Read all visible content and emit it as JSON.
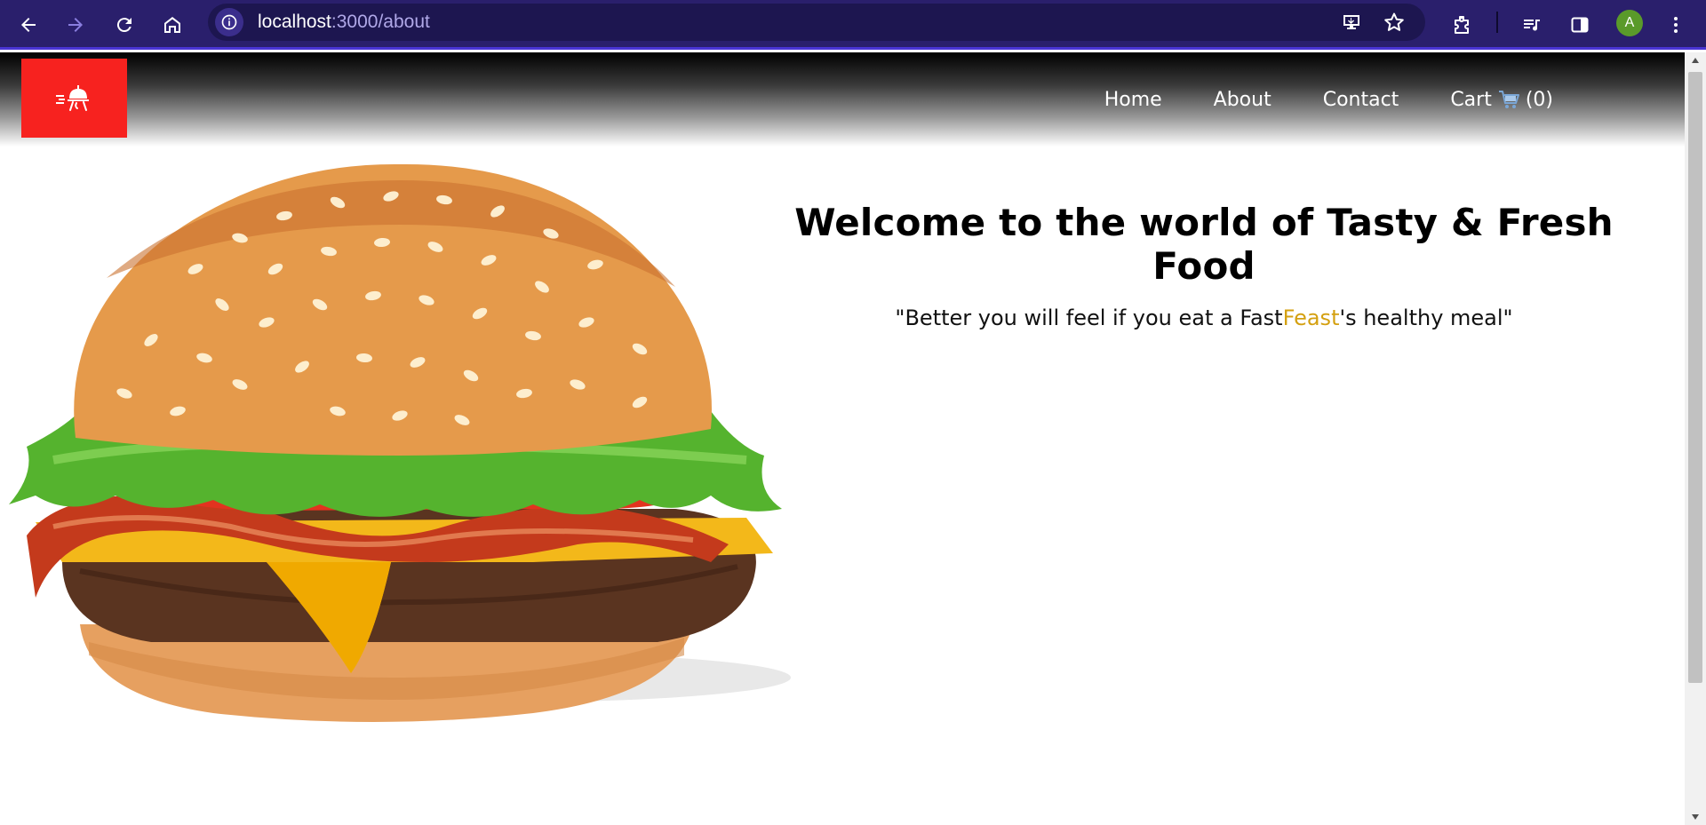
{
  "browser": {
    "url_host": "localhost",
    "url_path": ":3000/about",
    "profile_initial": "A",
    "icons": {
      "back": "back-arrow-icon",
      "forward": "forward-arrow-icon",
      "reload": "reload-icon",
      "home": "home-icon",
      "site_info": "info-icon",
      "install": "install-app-icon",
      "bookmark": "star-icon",
      "extensions": "puzzle-icon",
      "media": "media-queue-icon",
      "side_panel": "side-panel-icon",
      "menu": "kebab-menu-icon"
    }
  },
  "site": {
    "logo_icon": "delivery-bell-icon",
    "logo_color": "#f7221f",
    "nav": {
      "home": "Home",
      "about": "About",
      "contact": "Contact",
      "cart_label": "Cart",
      "cart_count": "(0)",
      "cart_icon": "shopping-cart-icon"
    }
  },
  "hero": {
    "title": "Welcome to the world of Tasty & Fresh Food",
    "subtitle_before": "\"Better you will feel if you eat a Fast",
    "subtitle_accent": "Feast",
    "subtitle_after": "'s healthy meal\"",
    "accent_color": "#d4a010",
    "image": "burger-image"
  }
}
